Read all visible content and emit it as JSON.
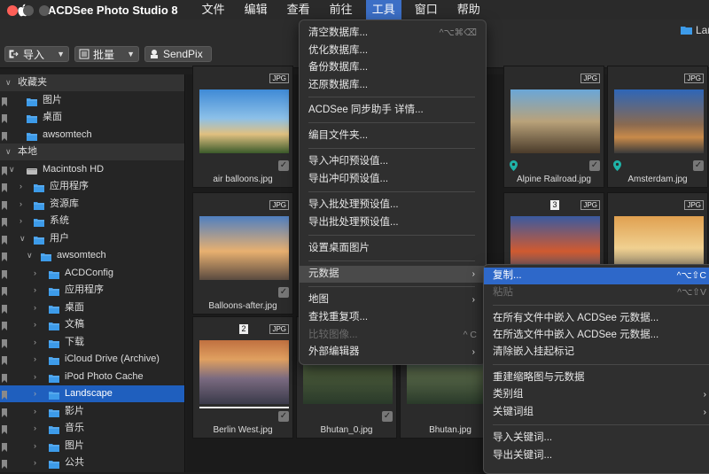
{
  "menubar": {
    "app_name": "ACDSee Photo Studio 8",
    "items": [
      "文件",
      "编辑",
      "查看",
      "前往",
      "工具",
      "窗口",
      "帮助"
    ],
    "active_index": 4
  },
  "window": {
    "folder_title": "Lan"
  },
  "toolbar": {
    "import_label": "导入",
    "batch_label": "批量",
    "sendpix_label": "SendPix"
  },
  "sidebar": {
    "favorites_header": "收藏夹",
    "favorites": [
      "图片",
      "桌面",
      "awsomtech"
    ],
    "local_header": "本地",
    "tree": [
      {
        "label": "Macintosh HD",
        "level": 1
      },
      {
        "label": "应用程序",
        "level": 2
      },
      {
        "label": "资源库",
        "level": 2
      },
      {
        "label": "系统",
        "level": 2
      },
      {
        "label": "用户",
        "level": 2
      },
      {
        "label": "awsomtech",
        "level": 3
      },
      {
        "label": "ACDConfig",
        "level": 4
      },
      {
        "label": "应用程序",
        "level": 4
      },
      {
        "label": "桌面",
        "level": 4
      },
      {
        "label": "文稿",
        "level": 4
      },
      {
        "label": "下载",
        "level": 4
      },
      {
        "label": "iCloud Drive (Archive)",
        "level": 4
      },
      {
        "label": "iPod Photo Cache",
        "level": 4
      },
      {
        "label": "Landscape",
        "level": 4
      },
      {
        "label": "影片",
        "level": 4
      },
      {
        "label": "音乐",
        "level": 4
      },
      {
        "label": "图片",
        "level": 4
      },
      {
        "label": "公共",
        "level": 4
      }
    ],
    "selected_label": "Landscape"
  },
  "thumbnails": {
    "badge": "JPG",
    "items": [
      {
        "caption": "air balloons.jpg"
      },
      {
        "caption": "Alpine Railroad.jpg"
      },
      {
        "caption": "Amsterdam.jpg"
      },
      {
        "caption": "Balloons-after.jpg"
      },
      {
        "caption": "Berlin West.jpg",
        "number": "2"
      },
      {
        "caption": "Bhutan_0.jpg"
      },
      {
        "caption": "Bhutan.jpg"
      },
      {
        "caption": "",
        "number": "3"
      },
      {
        "caption": ""
      }
    ]
  },
  "tools_menu": {
    "items": [
      {
        "label": "清空数据库...",
        "shortcut": "^⌥⌘⌫"
      },
      {
        "label": "优化数据库..."
      },
      {
        "label": "备份数据库..."
      },
      {
        "label": "还原数据库..."
      },
      {
        "label": "ACDSee 同步助手 详情..."
      },
      {
        "label": "编目文件夹..."
      },
      {
        "label": "导入冲印预设值..."
      },
      {
        "label": "导出冲印预设值..."
      },
      {
        "label": "导入批处理预设值..."
      },
      {
        "label": "导出批处理预设值..."
      },
      {
        "label": "设置桌面图片"
      },
      {
        "label": "元数据"
      },
      {
        "label": "地图"
      },
      {
        "label": "查找重复项..."
      },
      {
        "label": "比较图像...",
        "shortcut": "^ C"
      },
      {
        "label": "外部编辑器"
      }
    ]
  },
  "metadata_submenu": {
    "items": [
      {
        "label": "复制...",
        "shortcut": "^⌥⇧C"
      },
      {
        "label": "粘贴",
        "shortcut": "^⌥⇧V"
      },
      {
        "label": "在所有文件中嵌入 ACDSee 元数据..."
      },
      {
        "label": "在所选文件中嵌入 ACDSee 元数据..."
      },
      {
        "label": "清除嵌入挂起标记"
      },
      {
        "label": "重建缩略图与元数据"
      },
      {
        "label": "类别组"
      },
      {
        "label": "关键词组"
      },
      {
        "label": "导入关键词..."
      },
      {
        "label": "导出关键词..."
      }
    ]
  },
  "colors": {
    "accent": "#2e68c9",
    "selection": "#1f5fbe",
    "folder": "#3d9be9"
  }
}
